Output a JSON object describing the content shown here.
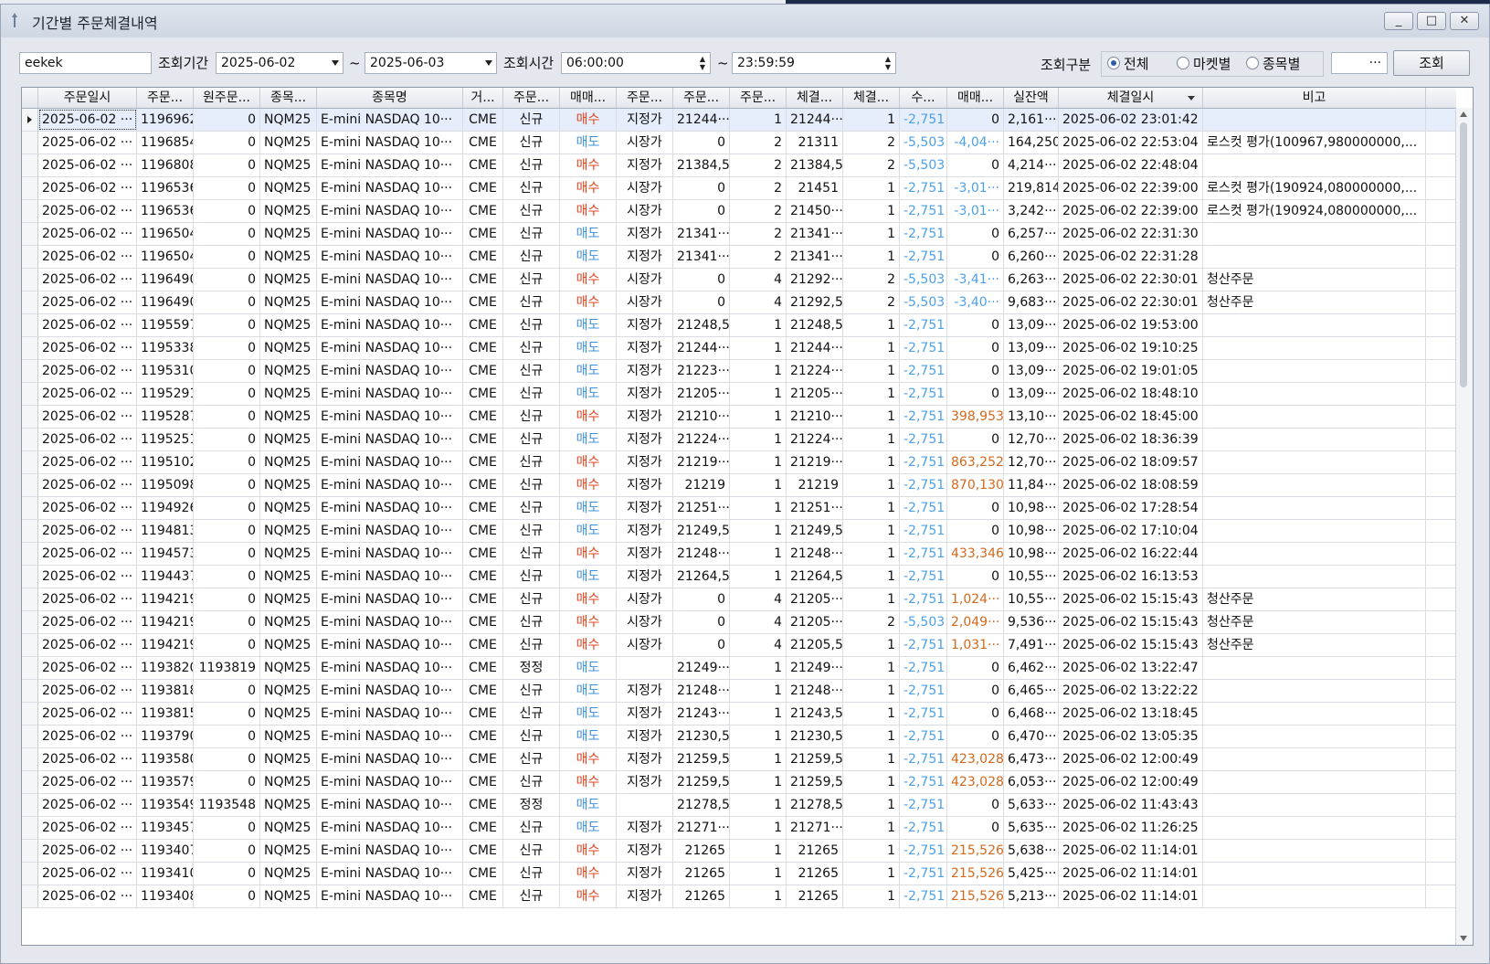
{
  "window": {
    "title": "기간별 주문체결내역",
    "min": "_",
    "max": "□",
    "close": "✕"
  },
  "toolbar": {
    "account": "eekek",
    "period_label": "조회기간",
    "date_from": "2025-06-02",
    "tilde": "~",
    "date_to": "2025-06-03",
    "time_label": "조회시간",
    "time_from": "06:00:00",
    "time_to": "23:59:59",
    "filter_label": "조회구분",
    "radio_all": "전체",
    "radio_market": "마켓별",
    "radio_symbol": "종목별",
    "symbol_value": "",
    "more": "···",
    "search": "조회"
  },
  "columns": [
    "주문일시",
    "주문...",
    "원주문...",
    "종목...",
    "종목명",
    "거...",
    "주문...",
    "매매...",
    "주문...",
    "주문...",
    "주문...",
    "체결...",
    "체결...",
    "수...",
    "매매...",
    "실잔액",
    "체결일시",
    "비고"
  ],
  "rows": [
    {
      "d": "2025-06-02 ···",
      "no": "1196962",
      "orig": "0",
      "code": "NQM25",
      "name": "E-mini NASDAQ 10···",
      "ex": "CME",
      "type": "신규",
      "side": "매수",
      "cond": "지정가",
      "price": "21244···",
      "qty": "1",
      "fprice": "21244···",
      "fqty": "1",
      "fee": "-2,751",
      "pl": "0",
      "bal": "2,161···",
      "ftime": "2025-06-02 23:01:42",
      "note": ""
    },
    {
      "d": "2025-06-02 ···",
      "no": "1196854",
      "orig": "0",
      "code": "NQM25",
      "name": "E-mini NASDAQ 10···",
      "ex": "CME",
      "type": "신규",
      "side": "매도",
      "cond": "시장가",
      "price": "0",
      "qty": "2",
      "fprice": "21311",
      "fqty": "2",
      "fee": "-5,503",
      "pl": "-4,04···",
      "bal": "164,250",
      "ftime": "2025-06-02 22:53:04",
      "note": "로스컷 평가(100967,980000000,..."
    },
    {
      "d": "2025-06-02 ···",
      "no": "1196808",
      "orig": "0",
      "code": "NQM25",
      "name": "E-mini NASDAQ 10···",
      "ex": "CME",
      "type": "신규",
      "side": "매수",
      "cond": "지정가",
      "price": "21384,5",
      "qty": "2",
      "fprice": "21384,5",
      "fqty": "2",
      "fee": "-5,503",
      "pl": "0",
      "bal": "4,214···",
      "ftime": "2025-06-02 22:48:04",
      "note": ""
    },
    {
      "d": "2025-06-02 ···",
      "no": "1196536",
      "orig": "0",
      "code": "NQM25",
      "name": "E-mini NASDAQ 10···",
      "ex": "CME",
      "type": "신규",
      "side": "매수",
      "cond": "시장가",
      "price": "0",
      "qty": "2",
      "fprice": "21451",
      "fqty": "1",
      "fee": "-2,751",
      "pl": "-3,01···",
      "bal": "219,814",
      "ftime": "2025-06-02 22:39:00",
      "note": "로스컷 평가(190924,080000000,..."
    },
    {
      "d": "2025-06-02 ···",
      "no": "1196536",
      "orig": "0",
      "code": "NQM25",
      "name": "E-mini NASDAQ 10···",
      "ex": "CME",
      "type": "신규",
      "side": "매수",
      "cond": "시장가",
      "price": "0",
      "qty": "2",
      "fprice": "21450···",
      "fqty": "1",
      "fee": "-2,751",
      "pl": "-3,01···",
      "bal": "3,242···",
      "ftime": "2025-06-02 22:39:00",
      "note": "로스컷 평가(190924,080000000,..."
    },
    {
      "d": "2025-06-02 ···",
      "no": "1196504",
      "orig": "0",
      "code": "NQM25",
      "name": "E-mini NASDAQ 10···",
      "ex": "CME",
      "type": "신규",
      "side": "매도",
      "cond": "지정가",
      "price": "21341···",
      "qty": "2",
      "fprice": "21341···",
      "fqty": "1",
      "fee": "-2,751",
      "pl": "0",
      "bal": "6,257···",
      "ftime": "2025-06-02 22:31:30",
      "note": ""
    },
    {
      "d": "2025-06-02 ···",
      "no": "1196504",
      "orig": "0",
      "code": "NQM25",
      "name": "E-mini NASDAQ 10···",
      "ex": "CME",
      "type": "신규",
      "side": "매도",
      "cond": "지정가",
      "price": "21341···",
      "qty": "2",
      "fprice": "21341···",
      "fqty": "1",
      "fee": "-2,751",
      "pl": "0",
      "bal": "6,260···",
      "ftime": "2025-06-02 22:31:28",
      "note": ""
    },
    {
      "d": "2025-06-02 ···",
      "no": "1196490",
      "orig": "0",
      "code": "NQM25",
      "name": "E-mini NASDAQ 10···",
      "ex": "CME",
      "type": "신규",
      "side": "매수",
      "cond": "시장가",
      "price": "0",
      "qty": "4",
      "fprice": "21292···",
      "fqty": "2",
      "fee": "-5,503",
      "pl": "-3,41···",
      "bal": "6,263···",
      "ftime": "2025-06-02 22:30:01",
      "note": "청산주문"
    },
    {
      "d": "2025-06-02 ···",
      "no": "1196490",
      "orig": "0",
      "code": "NQM25",
      "name": "E-mini NASDAQ 10···",
      "ex": "CME",
      "type": "신규",
      "side": "매수",
      "cond": "시장가",
      "price": "0",
      "qty": "4",
      "fprice": "21292,5",
      "fqty": "2",
      "fee": "-5,503",
      "pl": "-3,40···",
      "bal": "9,683···",
      "ftime": "2025-06-02 22:30:01",
      "note": "청산주문"
    },
    {
      "d": "2025-06-02 ···",
      "no": "1195597",
      "orig": "0",
      "code": "NQM25",
      "name": "E-mini NASDAQ 10···",
      "ex": "CME",
      "type": "신규",
      "side": "매도",
      "cond": "지정가",
      "price": "21248,5",
      "qty": "1",
      "fprice": "21248,5",
      "fqty": "1",
      "fee": "-2,751",
      "pl": "0",
      "bal": "13,09···",
      "ftime": "2025-06-02 19:53:00",
      "note": ""
    },
    {
      "d": "2025-06-02 ···",
      "no": "1195338",
      "orig": "0",
      "code": "NQM25",
      "name": "E-mini NASDAQ 10···",
      "ex": "CME",
      "type": "신규",
      "side": "매도",
      "cond": "지정가",
      "price": "21244···",
      "qty": "1",
      "fprice": "21244···",
      "fqty": "1",
      "fee": "-2,751",
      "pl": "0",
      "bal": "13,09···",
      "ftime": "2025-06-02 19:10:25",
      "note": ""
    },
    {
      "d": "2025-06-02 ···",
      "no": "1195310",
      "orig": "0",
      "code": "NQM25",
      "name": "E-mini NASDAQ 10···",
      "ex": "CME",
      "type": "신규",
      "side": "매도",
      "cond": "지정가",
      "price": "21223···",
      "qty": "1",
      "fprice": "21224···",
      "fqty": "1",
      "fee": "-2,751",
      "pl": "0",
      "bal": "13,09···",
      "ftime": "2025-06-02 19:01:05",
      "note": ""
    },
    {
      "d": "2025-06-02 ···",
      "no": "1195291",
      "orig": "0",
      "code": "NQM25",
      "name": "E-mini NASDAQ 10···",
      "ex": "CME",
      "type": "신규",
      "side": "매도",
      "cond": "지정가",
      "price": "21205···",
      "qty": "1",
      "fprice": "21205···",
      "fqty": "1",
      "fee": "-2,751",
      "pl": "0",
      "bal": "13,09···",
      "ftime": "2025-06-02 18:48:10",
      "note": ""
    },
    {
      "d": "2025-06-02 ···",
      "no": "1195287",
      "orig": "0",
      "code": "NQM25",
      "name": "E-mini NASDAQ 10···",
      "ex": "CME",
      "type": "신규",
      "side": "매수",
      "cond": "지정가",
      "price": "21210···",
      "qty": "1",
      "fprice": "21210···",
      "fqty": "1",
      "fee": "-2,751",
      "pl": "398,953",
      "bal": "13,10···",
      "ftime": "2025-06-02 18:45:00",
      "note": ""
    },
    {
      "d": "2025-06-02 ···",
      "no": "1195251",
      "orig": "0",
      "code": "NQM25",
      "name": "E-mini NASDAQ 10···",
      "ex": "CME",
      "type": "신규",
      "side": "매도",
      "cond": "지정가",
      "price": "21224···",
      "qty": "1",
      "fprice": "21224···",
      "fqty": "1",
      "fee": "-2,751",
      "pl": "0",
      "bal": "12,70···",
      "ftime": "2025-06-02 18:36:39",
      "note": ""
    },
    {
      "d": "2025-06-02 ···",
      "no": "1195102",
      "orig": "0",
      "code": "NQM25",
      "name": "E-mini NASDAQ 10···",
      "ex": "CME",
      "type": "신규",
      "side": "매수",
      "cond": "지정가",
      "price": "21219···",
      "qty": "1",
      "fprice": "21219···",
      "fqty": "1",
      "fee": "-2,751",
      "pl": "863,252",
      "bal": "12,70···",
      "ftime": "2025-06-02 18:09:57",
      "note": ""
    },
    {
      "d": "2025-06-02 ···",
      "no": "1195098",
      "orig": "0",
      "code": "NQM25",
      "name": "E-mini NASDAQ 10···",
      "ex": "CME",
      "type": "신규",
      "side": "매수",
      "cond": "지정가",
      "price": "21219",
      "qty": "1",
      "fprice": "21219",
      "fqty": "1",
      "fee": "-2,751",
      "pl": "870,130",
      "bal": "11,84···",
      "ftime": "2025-06-02 18:08:59",
      "note": ""
    },
    {
      "d": "2025-06-02 ···",
      "no": "1194926",
      "orig": "0",
      "code": "NQM25",
      "name": "E-mini NASDAQ 10···",
      "ex": "CME",
      "type": "신규",
      "side": "매도",
      "cond": "지정가",
      "price": "21251···",
      "qty": "1",
      "fprice": "21251···",
      "fqty": "1",
      "fee": "-2,751",
      "pl": "0",
      "bal": "10,98···",
      "ftime": "2025-06-02 17:28:54",
      "note": ""
    },
    {
      "d": "2025-06-02 ···",
      "no": "1194813",
      "orig": "0",
      "code": "NQM25",
      "name": "E-mini NASDAQ 10···",
      "ex": "CME",
      "type": "신규",
      "side": "매도",
      "cond": "지정가",
      "price": "21249,5",
      "qty": "1",
      "fprice": "21249,5",
      "fqty": "1",
      "fee": "-2,751",
      "pl": "0",
      "bal": "10,98···",
      "ftime": "2025-06-02 17:10:04",
      "note": ""
    },
    {
      "d": "2025-06-02 ···",
      "no": "1194573",
      "orig": "0",
      "code": "NQM25",
      "name": "E-mini NASDAQ 10···",
      "ex": "CME",
      "type": "신규",
      "side": "매수",
      "cond": "지정가",
      "price": "21248···",
      "qty": "1",
      "fprice": "21248···",
      "fqty": "1",
      "fee": "-2,751",
      "pl": "433,346",
      "bal": "10,98···",
      "ftime": "2025-06-02 16:22:44",
      "note": ""
    },
    {
      "d": "2025-06-02 ···",
      "no": "1194437",
      "orig": "0",
      "code": "NQM25",
      "name": "E-mini NASDAQ 10···",
      "ex": "CME",
      "type": "신규",
      "side": "매도",
      "cond": "지정가",
      "price": "21264,5",
      "qty": "1",
      "fprice": "21264,5",
      "fqty": "1",
      "fee": "-2,751",
      "pl": "0",
      "bal": "10,55···",
      "ftime": "2025-06-02 16:13:53",
      "note": ""
    },
    {
      "d": "2025-06-02 ···",
      "no": "1194219",
      "orig": "0",
      "code": "NQM25",
      "name": "E-mini NASDAQ 10···",
      "ex": "CME",
      "type": "신규",
      "side": "매수",
      "cond": "시장가",
      "price": "0",
      "qty": "4",
      "fprice": "21205···",
      "fqty": "1",
      "fee": "-2,751",
      "pl": "1,024···",
      "bal": "10,55···",
      "ftime": "2025-06-02 15:15:43",
      "note": "청산주문"
    },
    {
      "d": "2025-06-02 ···",
      "no": "1194219",
      "orig": "0",
      "code": "NQM25",
      "name": "E-mini NASDAQ 10···",
      "ex": "CME",
      "type": "신규",
      "side": "매수",
      "cond": "시장가",
      "price": "0",
      "qty": "4",
      "fprice": "21205···",
      "fqty": "2",
      "fee": "-5,503",
      "pl": "2,049···",
      "bal": "9,536···",
      "ftime": "2025-06-02 15:15:43",
      "note": "청산주문"
    },
    {
      "d": "2025-06-02 ···",
      "no": "1194219",
      "orig": "0",
      "code": "NQM25",
      "name": "E-mini NASDAQ 10···",
      "ex": "CME",
      "type": "신규",
      "side": "매수",
      "cond": "시장가",
      "price": "0",
      "qty": "4",
      "fprice": "21205,5",
      "fqty": "1",
      "fee": "-2,751",
      "pl": "1,031···",
      "bal": "7,491···",
      "ftime": "2025-06-02 15:15:43",
      "note": "청산주문"
    },
    {
      "d": "2025-06-02 ···",
      "no": "1193820",
      "orig": "1193819",
      "code": "NQM25",
      "name": "E-mini NASDAQ 10···",
      "ex": "CME",
      "type": "정정",
      "side": "매도",
      "cond": "",
      "price": "21249···",
      "qty": "1",
      "fprice": "21249···",
      "fqty": "1",
      "fee": "-2,751",
      "pl": "0",
      "bal": "6,462···",
      "ftime": "2025-06-02 13:22:47",
      "note": ""
    },
    {
      "d": "2025-06-02 ···",
      "no": "1193818",
      "orig": "0",
      "code": "NQM25",
      "name": "E-mini NASDAQ 10···",
      "ex": "CME",
      "type": "신규",
      "side": "매도",
      "cond": "지정가",
      "price": "21248···",
      "qty": "1",
      "fprice": "21248···",
      "fqty": "1",
      "fee": "-2,751",
      "pl": "0",
      "bal": "6,465···",
      "ftime": "2025-06-02 13:22:22",
      "note": ""
    },
    {
      "d": "2025-06-02 ···",
      "no": "1193815",
      "orig": "0",
      "code": "NQM25",
      "name": "E-mini NASDAQ 10···",
      "ex": "CME",
      "type": "신규",
      "side": "매도",
      "cond": "지정가",
      "price": "21243···",
      "qty": "1",
      "fprice": "21243,5",
      "fqty": "1",
      "fee": "-2,751",
      "pl": "0",
      "bal": "6,468···",
      "ftime": "2025-06-02 13:18:45",
      "note": ""
    },
    {
      "d": "2025-06-02 ···",
      "no": "1193790",
      "orig": "0",
      "code": "NQM25",
      "name": "E-mini NASDAQ 10···",
      "ex": "CME",
      "type": "신규",
      "side": "매도",
      "cond": "지정가",
      "price": "21230,5",
      "qty": "1",
      "fprice": "21230,5",
      "fqty": "1",
      "fee": "-2,751",
      "pl": "0",
      "bal": "6,470···",
      "ftime": "2025-06-02 13:05:35",
      "note": ""
    },
    {
      "d": "2025-06-02 ···",
      "no": "1193580",
      "orig": "0",
      "code": "NQM25",
      "name": "E-mini NASDAQ 10···",
      "ex": "CME",
      "type": "신규",
      "side": "매수",
      "cond": "지정가",
      "price": "21259,5",
      "qty": "1",
      "fprice": "21259,5",
      "fqty": "1",
      "fee": "-2,751",
      "pl": "423,028",
      "bal": "6,473···",
      "ftime": "2025-06-02 12:00:49",
      "note": ""
    },
    {
      "d": "2025-06-02 ···",
      "no": "1193579",
      "orig": "0",
      "code": "NQM25",
      "name": "E-mini NASDAQ 10···",
      "ex": "CME",
      "type": "신규",
      "side": "매수",
      "cond": "지정가",
      "price": "21259,5",
      "qty": "1",
      "fprice": "21259,5",
      "fqty": "1",
      "fee": "-2,751",
      "pl": "423,028",
      "bal": "6,053···",
      "ftime": "2025-06-02 12:00:49",
      "note": ""
    },
    {
      "d": "2025-06-02 ···",
      "no": "1193549",
      "orig": "1193548",
      "code": "NQM25",
      "name": "E-mini NASDAQ 10···",
      "ex": "CME",
      "type": "정정",
      "side": "매도",
      "cond": "",
      "price": "21278,5",
      "qty": "1",
      "fprice": "21278,5",
      "fqty": "1",
      "fee": "-2,751",
      "pl": "0",
      "bal": "5,633···",
      "ftime": "2025-06-02 11:43:43",
      "note": ""
    },
    {
      "d": "2025-06-02 ···",
      "no": "1193457",
      "orig": "0",
      "code": "NQM25",
      "name": "E-mini NASDAQ 10···",
      "ex": "CME",
      "type": "신규",
      "side": "매도",
      "cond": "지정가",
      "price": "21271···",
      "qty": "1",
      "fprice": "21271···",
      "fqty": "1",
      "fee": "-2,751",
      "pl": "0",
      "bal": "5,635···",
      "ftime": "2025-06-02 11:26:25",
      "note": ""
    },
    {
      "d": "2025-06-02 ···",
      "no": "1193407",
      "orig": "0",
      "code": "NQM25",
      "name": "E-mini NASDAQ 10···",
      "ex": "CME",
      "type": "신규",
      "side": "매수",
      "cond": "지정가",
      "price": "21265",
      "qty": "1",
      "fprice": "21265",
      "fqty": "1",
      "fee": "-2,751",
      "pl": "215,526",
      "bal": "5,638···",
      "ftime": "2025-06-02 11:14:01",
      "note": ""
    },
    {
      "d": "2025-06-02 ···",
      "no": "1193410",
      "orig": "0",
      "code": "NQM25",
      "name": "E-mini NASDAQ 10···",
      "ex": "CME",
      "type": "신규",
      "side": "매수",
      "cond": "지정가",
      "price": "21265",
      "qty": "1",
      "fprice": "21265",
      "fqty": "1",
      "fee": "-2,751",
      "pl": "215,526",
      "bal": "5,425···",
      "ftime": "2025-06-02 11:14:01",
      "note": ""
    },
    {
      "d": "2025-06-02 ···",
      "no": "1193408",
      "orig": "0",
      "code": "NQM25",
      "name": "E-mini NASDAQ 10···",
      "ex": "CME",
      "type": "신규",
      "side": "매수",
      "cond": "지정가",
      "price": "21265",
      "qty": "1",
      "fprice": "21265",
      "fqty": "1",
      "fee": "-2,751",
      "pl": "215,526",
      "bal": "5,213···",
      "ftime": "2025-06-02 11:14:01",
      "note": ""
    }
  ],
  "colors": {
    "buy": "#e8421f",
    "sell": "#3f8fe0",
    "fee": "#4da0e8",
    "profit": "#d2691e",
    "selected_row": "#e6eefb"
  }
}
